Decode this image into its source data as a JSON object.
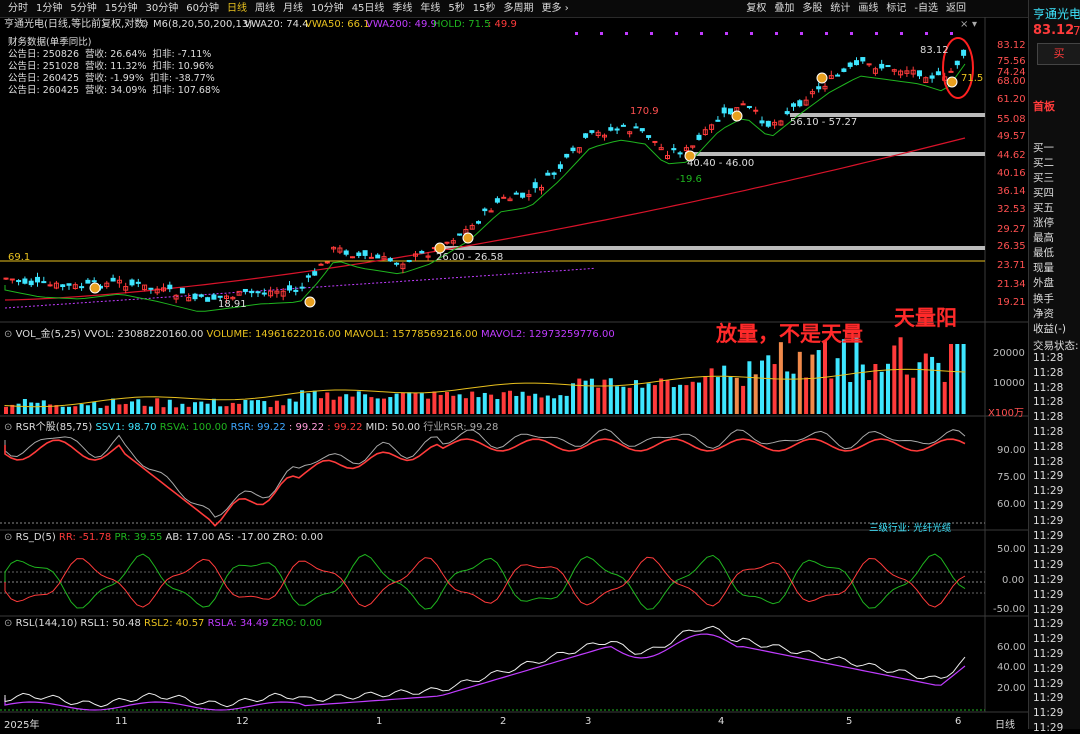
{
  "top_tabs": [
    "分时",
    "1分钟",
    "5分钟",
    "15分钟",
    "30分钟",
    "60分钟",
    "日线",
    "周线",
    "月线",
    "10分钟",
    "45日线",
    "季线",
    "年线",
    "5秒",
    "15秒",
    "多周期",
    "更多 ›"
  ],
  "active_tab": "日线",
  "top_tools": [
    "复权",
    "叠加",
    "多股",
    "统计",
    "画线",
    "标记",
    "-自选",
    "返回"
  ],
  "title": {
    "stock": "亨通光电(日线,等比前复权,对数)",
    "m6": "M6(8,20,50,200,13)",
    "vwa20": "VWA20: 74.4",
    "vwa50": "VWA50: 66.1",
    "vwa200": "VWA200: 49.9",
    "hold": "HOLD: 71.5",
    "hold_tail": ": 49.9"
  },
  "financial": {
    "header": "财务数据(单季同比)",
    "rows": [
      "公告日: 250826  营收: 26.64%  扣非: -7.11%",
      "公告日: 251028  营收: 11.32%  扣非: 10.96%",
      "公告日: 260425  营收: -1.99%  扣非: -38.77%",
      "公告日: 260425  营收: 34.09%  扣非: 107.68%"
    ]
  },
  "price_axis": [
    "83.12",
    "75.56",
    "74.24",
    "68.00",
    "61.20",
    "55.08",
    "49.57",
    "44.62",
    "40.16",
    "36.14",
    "32.53",
    "29.27",
    "26.35",
    "23.71",
    "21.34",
    "19.21"
  ],
  "chart_labels": {
    "hi_170": "170.9",
    "low_18": "18.91",
    "p69": "69.1",
    "zone1": "26.00 - 26.58",
    "zone2": "40.40 - 46.00",
    "zone3": "56.10 - 57.27",
    "neg19": "-19.6",
    "last": "83.12",
    "hold_val": "71.5"
  },
  "annotations": {
    "a1": "放量，不是天量",
    "a2": "天量阳"
  },
  "volume": {
    "header": "VOL_金(5,25)",
    "vvol": "VVOL: 23088220160.00",
    "volume": "VOLUME: 14961622016.00",
    "mavol1": "MAVOL1: 15778569216.00",
    "mavol2": "MAVOL2: 12973259776.00",
    "axis": [
      "20000",
      "10000",
      "X100万"
    ]
  },
  "rsr": {
    "header": "RSR个股(85,75)",
    "ssv1": "SSV1: 98.70",
    "rsva": "RSVA: 100.00",
    "rsr": "RSR: 99.22",
    "rsr2": ": 99.22",
    "rsr3": ": 99.22",
    "mid": "MID: 50.00",
    "ind": "行业RSR: 99.28",
    "axis": [
      "90.00",
      "75.00",
      "60.00"
    ],
    "industry_note": "三级行业: 光纤光缆"
  },
  "rsd": {
    "header": "RS_D(5)",
    "rr": "RR: -51.78",
    "pr": "PR: 39.55",
    "ab": "AB: 17.00",
    "as": "AS: -17.00",
    "zro": "ZRO: 0.00",
    "axis": [
      "50.00",
      "0.00",
      "-50.00"
    ]
  },
  "rsl": {
    "header": "RSL(144,10)",
    "rsl1": "RSL1: 50.48",
    "rsl2": "RSL2: 40.57",
    "rsla": "RSLA: 34.49",
    "zro": "ZRO: 0.00",
    "axis": [
      "60.00",
      "40.00",
      "20.00"
    ]
  },
  "x_axis": [
    "2025年",
    "11",
    "12",
    "1",
    "2",
    "3",
    "4",
    "5",
    "6"
  ],
  "x_axis_right": "日线",
  "right_panel": {
    "name": "亨通光电",
    "price": "83.12",
    "price_tail": "7.",
    "buy": "买",
    "first_board": "首板",
    "levels": [
      "买一",
      "买二",
      "买三",
      "买四",
      "买五",
      "涨停",
      "最高",
      "最低",
      "现量",
      "外盘",
      "换手",
      "净资",
      "收益(-)",
      "交易状态:"
    ],
    "times": [
      "11:28",
      "11:28",
      "11:28",
      "11:28",
      "11:28",
      "11:28",
      "11:28",
      "11:28",
      "11:29",
      "11:29",
      "11:29",
      "11:29",
      "11:29",
      "11:29",
      "11:29",
      "11:29",
      "11:29",
      "11:29",
      "11:29",
      "11:29",
      "11:29",
      "11:29",
      "11:29",
      "11:29",
      "11:29",
      "11:29"
    ]
  },
  "colors": {
    "up": "#ff3b3b",
    "down": "#3ee6ff",
    "ma_green": "#1fb51f",
    "ma_red": "#d8132a",
    "vol_orange": "#f08a4b",
    "yellow": "#e8c11e",
    "purple": "#c03cff",
    "annot": "#ff2020"
  }
}
